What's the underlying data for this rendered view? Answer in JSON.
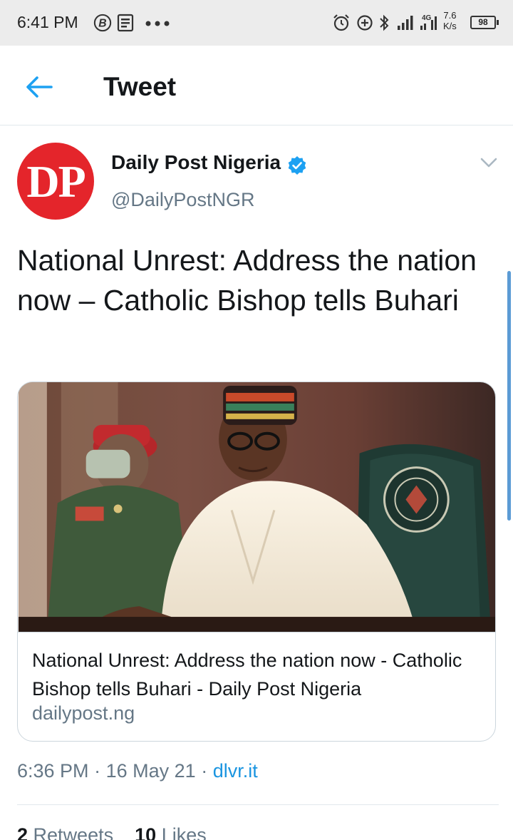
{
  "status_bar": {
    "time": "6:41 PM",
    "net_speed": "7.6",
    "net_unit": "K/s",
    "battery": "98",
    "network_type": "4G"
  },
  "header": {
    "title": "Tweet",
    "back_icon": "arrow-left-icon"
  },
  "tweet": {
    "author": {
      "avatar_text": "DP",
      "name": "Daily Post Nigeria",
      "handle": "@DailyPostNGR",
      "verified": true
    },
    "text": "National Unrest: Address the nation now – Catholic Bishop tells Buhari",
    "card": {
      "title": "National Unrest: Address the nation now - Catholic Bishop tells Buhari - Daily Post Nigeria",
      "domain": "dailypost.ng"
    },
    "time": "6:36 PM",
    "separator": "·",
    "date": "16 May 21",
    "source": "dlvr.it",
    "retweets_count": "2",
    "retweets_label": "Retweets",
    "likes_count": "10",
    "likes_label": "Likes"
  },
  "colors": {
    "accent": "#1da1f2",
    "avatar_red": "#e4252b",
    "secondary_text": "#657786"
  }
}
